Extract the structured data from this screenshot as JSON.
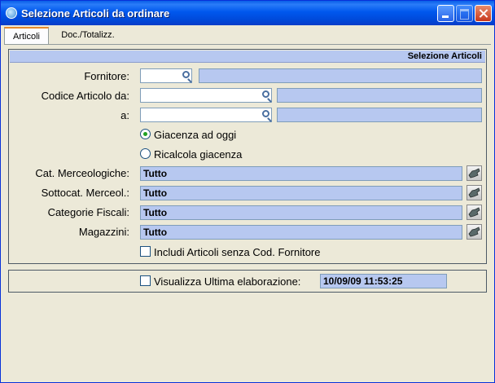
{
  "window": {
    "title": "Selezione Articoli da ordinare"
  },
  "tabs": [
    {
      "label": "Articoli",
      "active": true
    },
    {
      "label": "Doc./Totalizz.",
      "active": false
    }
  ],
  "section": {
    "header": "Selezione Articoli"
  },
  "form": {
    "fornitore": {
      "label": "Fornitore:",
      "code": "",
      "description": ""
    },
    "codice_da": {
      "label": "Codice Articolo da:",
      "value": "",
      "description": ""
    },
    "codice_a": {
      "label": "a:",
      "value": "",
      "description": ""
    },
    "radio_options": [
      {
        "label": "Giacenza ad oggi",
        "checked": true
      },
      {
        "label": "Ricalcola giacenza",
        "checked": false
      }
    ],
    "cat_merceologiche": {
      "label": "Cat. Merceologiche:",
      "value": "Tutto"
    },
    "sottocat_merceol": {
      "label": "Sottocat. Merceol.:",
      "value": "Tutto"
    },
    "categorie_fiscali": {
      "label": "Categorie Fiscali:",
      "value": "Tutto"
    },
    "magazzini": {
      "label": "Magazzini:",
      "value": "Tutto"
    },
    "includi_senza_cod": {
      "label": "Includi Articoli senza Cod. Fornitore",
      "checked": false
    }
  },
  "footer": {
    "visualizza": {
      "label": "Visualizza Ultima elaborazione:",
      "checked": false
    },
    "last_run": "10/09/09  11:53:25"
  },
  "colors": {
    "titlebar": "#0058ee",
    "readonly_field": "#b7c8f0",
    "window_bg": "#ece9d8",
    "radio_dot": "#21a121"
  }
}
